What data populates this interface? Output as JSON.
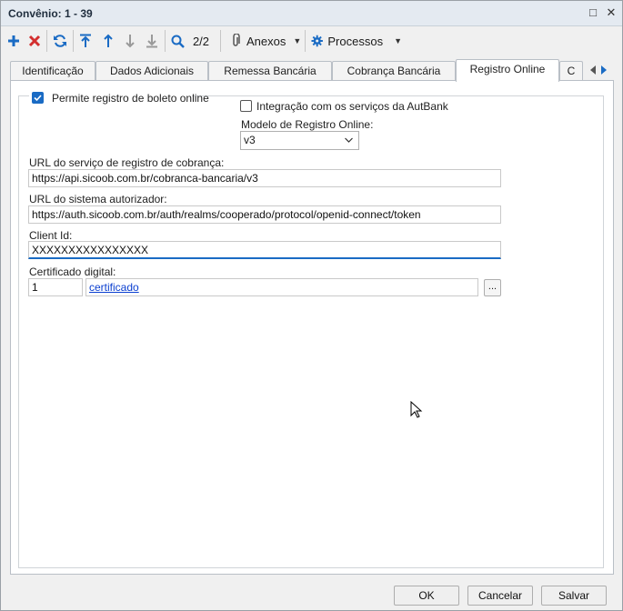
{
  "window": {
    "title": "Convênio: 1 - 39",
    "restore_glyph": "□",
    "close_glyph": "✕"
  },
  "toolbar": {
    "add_icon": "plus-icon",
    "delete_icon": "x-icon",
    "refresh_icon": "refresh-icon",
    "first_icon": "arrow-first-icon",
    "prev_icon": "arrow-up-icon",
    "next_icon": "arrow-down-icon",
    "last_icon": "arrow-last-icon",
    "search_icon": "search-icon",
    "record_position": "2/2",
    "attachments_label": "Anexos",
    "processes_label": "Processos"
  },
  "tabs": [
    {
      "label": "Identificação"
    },
    {
      "label": "Dados Adicionais"
    },
    {
      "label": "Remessa Bancária"
    },
    {
      "label": "Cobrança Bancária"
    },
    {
      "label": "Registro Online"
    },
    {
      "label": "C"
    }
  ],
  "active_tab": "Registro Online",
  "form": {
    "permite_registro_label": "Permite registro de boleto online",
    "permite_registro_checked": true,
    "integracao_label": "Integração com os serviços da AutBank",
    "integracao_checked": false,
    "modelo_label": "Modelo de Registro Online:",
    "modelo_value": "v3",
    "url_cobranca_label": "URL do serviço de registro de cobrança:",
    "url_cobranca_value": "https://api.sicoob.com.br/cobranca-bancaria/v3",
    "url_autorizador_label": "URL do sistema autorizador:",
    "url_autorizador_value": "https://auth.sicoob.com.br/auth/realms/cooperado/protocol/openid-connect/token",
    "client_id_label": "Client Id:",
    "client_id_value": "XXXXXXXXXXXXXXXX",
    "certificado_label": "Certificado digital:",
    "certificado_code": "1",
    "certificado_link": "certificado",
    "certificado_browse": "..."
  },
  "buttons": {
    "ok": "OK",
    "cancel": "Cancelar",
    "save": "Salvar"
  },
  "colors": {
    "accent": "#1a6bc4",
    "delete": "#d32f2f",
    "link": "#0b3fd0"
  }
}
